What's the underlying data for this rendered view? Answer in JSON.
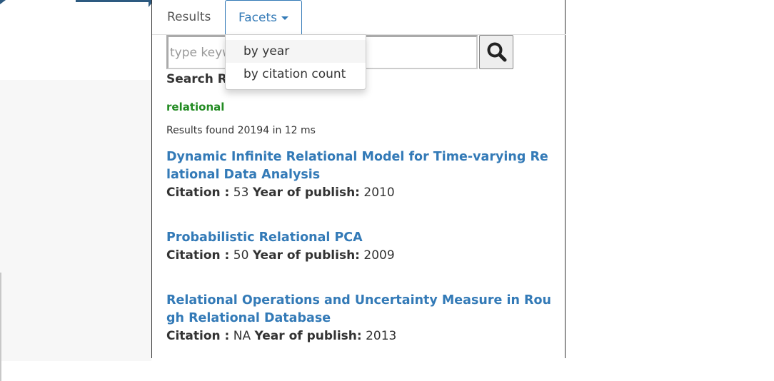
{
  "tabs": {
    "results": "Results",
    "facets": "Facets"
  },
  "facets_menu": {
    "items": [
      "by year",
      "by citation count"
    ]
  },
  "search": {
    "placeholder": "type keyw",
    "value": "",
    "button_icon": "search-icon"
  },
  "results_heading": "Search Re",
  "query_term": "relational",
  "results_summary": "Results found 20194 in 12 ms",
  "labels": {
    "citation": "Citation :",
    "year": "Year of publish:"
  },
  "results": [
    {
      "title": "Dynamic Infinite Relational Model for Time-varying Relational Data Analysis",
      "citation": "53",
      "year": "2010"
    },
    {
      "title": "Probabilistic Relational PCA",
      "citation": "50",
      "year": "2009"
    },
    {
      "title": "Relational Operations and Uncertainty Measure in Rough Relational Database",
      "citation": "NA",
      "year": "2013"
    }
  ],
  "colors": {
    "link": "#337ab7",
    "query": "#228b22",
    "accent_dark": "#2d5a80"
  }
}
